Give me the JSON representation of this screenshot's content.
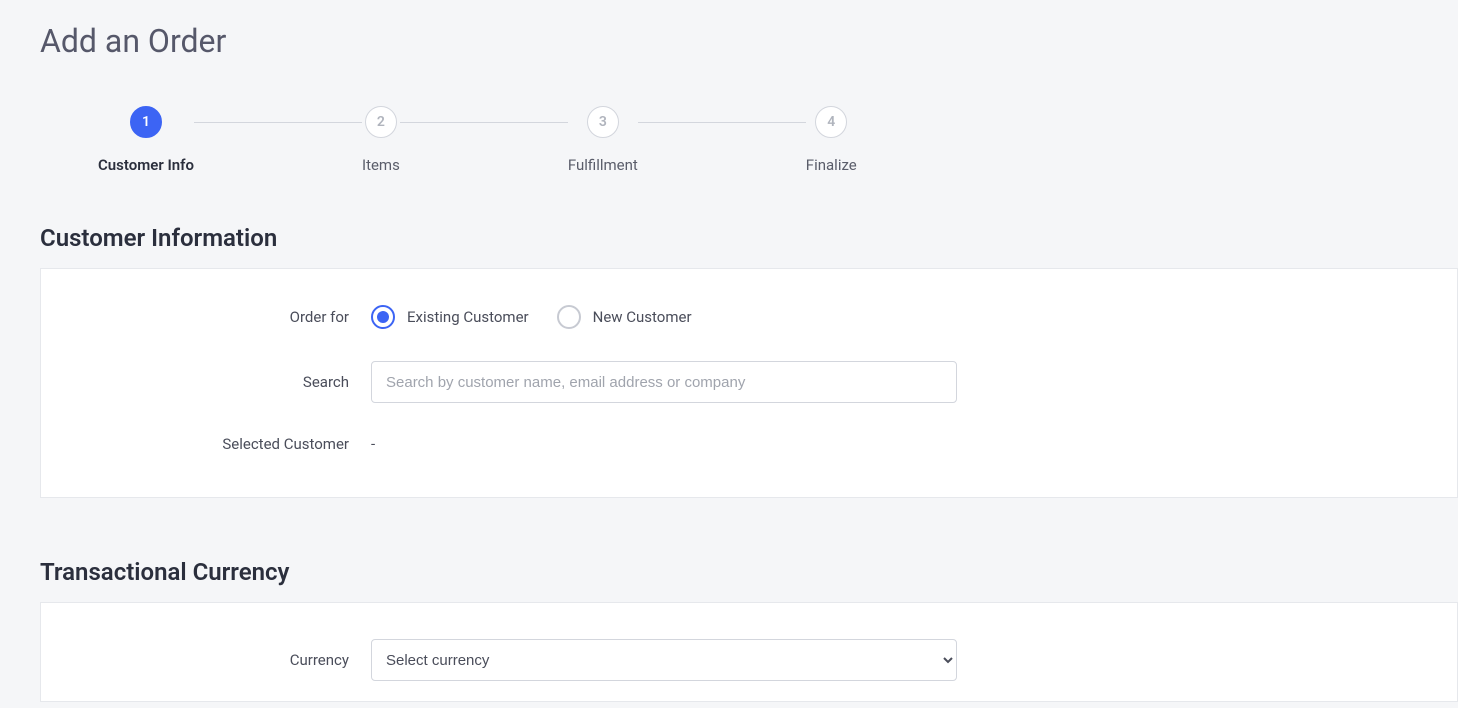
{
  "title": "Add an Order",
  "steps": [
    {
      "num": "1",
      "label": "Customer Info",
      "active": true
    },
    {
      "num": "2",
      "label": "Items",
      "active": false
    },
    {
      "num": "3",
      "label": "Fulfillment",
      "active": false
    },
    {
      "num": "4",
      "label": "Finalize",
      "active": false
    }
  ],
  "customer_section": {
    "heading": "Customer Information",
    "order_for_label": "Order for",
    "radio_existing": "Existing Customer",
    "radio_new": "New Customer",
    "search_label": "Search",
    "search_placeholder": "Search by customer name, email address or company",
    "selected_customer_label": "Selected Customer",
    "selected_customer_value": "-"
  },
  "currency_section": {
    "heading": "Transactional Currency",
    "currency_label": "Currency",
    "currency_placeholder": "Select currency"
  }
}
